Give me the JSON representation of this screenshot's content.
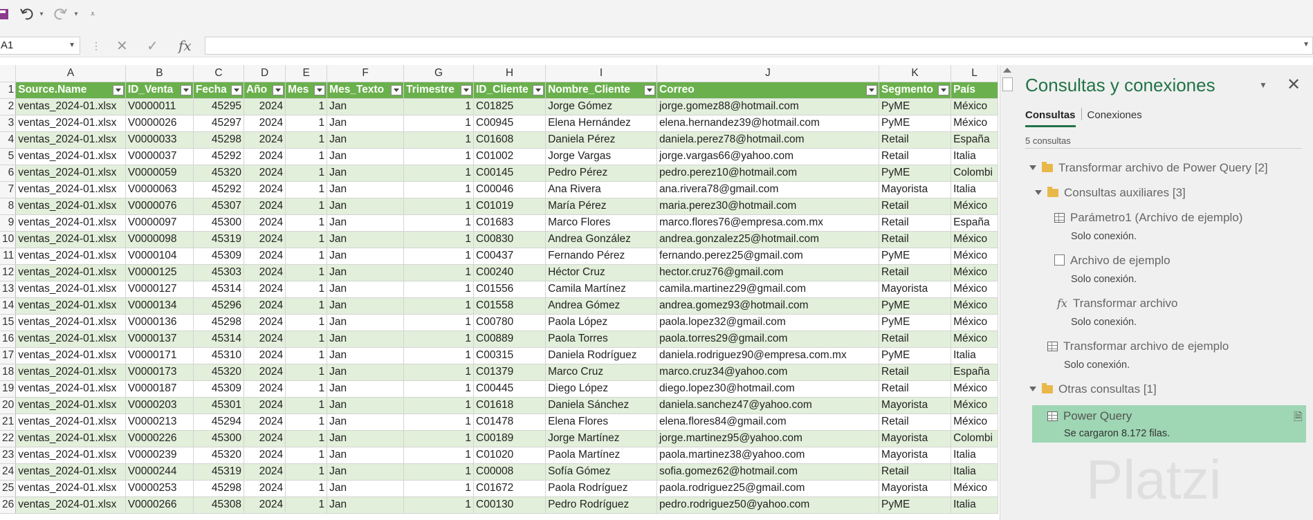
{
  "name_box": "A1",
  "formula_value": "",
  "columns": [
    "A",
    "B",
    "C",
    "D",
    "E",
    "F",
    "G",
    "H",
    "I",
    "J",
    "K",
    "L"
  ],
  "headers": [
    "Source.Name",
    "ID_Venta",
    "Fecha",
    "Año",
    "Mes",
    "Mes_Texto",
    "Trimestre",
    "ID_Cliente",
    "Nombre_Cliente",
    "Correo",
    "Segmento",
    "País"
  ],
  "rows": [
    {
      "n": "2",
      "source": "ventas_2024-01.xlsx",
      "id": "V0000011",
      "fecha": "45295",
      "anio": "2024",
      "mes": "1",
      "mtxt": "Jan",
      "trim": "1",
      "cli": "C01825",
      "nom": "Jorge Gómez",
      "mail": "jorge.gomez88@hotmail.com",
      "seg": "PyME",
      "pais": "México"
    },
    {
      "n": "3",
      "source": "ventas_2024-01.xlsx",
      "id": "V0000026",
      "fecha": "45297",
      "anio": "2024",
      "mes": "1",
      "mtxt": "Jan",
      "trim": "1",
      "cli": "C00945",
      "nom": "Elena Hernández",
      "mail": "elena.hernandez39@hotmail.com",
      "seg": "PyME",
      "pais": "México"
    },
    {
      "n": "4",
      "source": "ventas_2024-01.xlsx",
      "id": "V0000033",
      "fecha": "45298",
      "anio": "2024",
      "mes": "1",
      "mtxt": "Jan",
      "trim": "1",
      "cli": "C01608",
      "nom": "Daniela Pérez",
      "mail": "daniela.perez78@hotmail.com",
      "seg": "Retail",
      "pais": "España"
    },
    {
      "n": "5",
      "source": "ventas_2024-01.xlsx",
      "id": "V0000037",
      "fecha": "45292",
      "anio": "2024",
      "mes": "1",
      "mtxt": "Jan",
      "trim": "1",
      "cli": "C01002",
      "nom": "Jorge Vargas",
      "mail": "jorge.vargas66@yahoo.com",
      "seg": "Retail",
      "pais": "Italia"
    },
    {
      "n": "6",
      "source": "ventas_2024-01.xlsx",
      "id": "V0000059",
      "fecha": "45320",
      "anio": "2024",
      "mes": "1",
      "mtxt": "Jan",
      "trim": "1",
      "cli": "C00145",
      "nom": "Pedro Pérez",
      "mail": "pedro.perez10@hotmail.com",
      "seg": "PyME",
      "pais": "Colombi"
    },
    {
      "n": "7",
      "source": "ventas_2024-01.xlsx",
      "id": "V0000063",
      "fecha": "45292",
      "anio": "2024",
      "mes": "1",
      "mtxt": "Jan",
      "trim": "1",
      "cli": "C00046",
      "nom": "Ana Rivera",
      "mail": "ana.rivera78@gmail.com",
      "seg": "Mayorista",
      "pais": "Italia"
    },
    {
      "n": "8",
      "source": "ventas_2024-01.xlsx",
      "id": "V0000076",
      "fecha": "45307",
      "anio": "2024",
      "mes": "1",
      "mtxt": "Jan",
      "trim": "1",
      "cli": "C01019",
      "nom": "María Pérez",
      "mail": "maria.perez30@hotmail.com",
      "seg": "Retail",
      "pais": "México"
    },
    {
      "n": "9",
      "source": "ventas_2024-01.xlsx",
      "id": "V0000097",
      "fecha": "45300",
      "anio": "2024",
      "mes": "1",
      "mtxt": "Jan",
      "trim": "1",
      "cli": "C01683",
      "nom": "Marco Flores",
      "mail": "marco.flores76@empresa.com.mx",
      "seg": "Retail",
      "pais": "España"
    },
    {
      "n": "10",
      "source": "ventas_2024-01.xlsx",
      "id": "V0000098",
      "fecha": "45319",
      "anio": "2024",
      "mes": "1",
      "mtxt": "Jan",
      "trim": "1",
      "cli": "C00830",
      "nom": "Andrea González",
      "mail": "andrea.gonzalez25@hotmail.com",
      "seg": "Retail",
      "pais": "México"
    },
    {
      "n": "11",
      "source": "ventas_2024-01.xlsx",
      "id": "V0000104",
      "fecha": "45309",
      "anio": "2024",
      "mes": "1",
      "mtxt": "Jan",
      "trim": "1",
      "cli": "C00437",
      "nom": "Fernando Pérez",
      "mail": "fernando.perez25@gmail.com",
      "seg": "PyME",
      "pais": "México"
    },
    {
      "n": "12",
      "source": "ventas_2024-01.xlsx",
      "id": "V0000125",
      "fecha": "45303",
      "anio": "2024",
      "mes": "1",
      "mtxt": "Jan",
      "trim": "1",
      "cli": "C00240",
      "nom": "Héctor Cruz",
      "mail": "hector.cruz76@gmail.com",
      "seg": "Retail",
      "pais": "México"
    },
    {
      "n": "13",
      "source": "ventas_2024-01.xlsx",
      "id": "V0000127",
      "fecha": "45314",
      "anio": "2024",
      "mes": "1",
      "mtxt": "Jan",
      "trim": "1",
      "cli": "C01556",
      "nom": "Camila Martínez",
      "mail": "camila.martinez29@gmail.com",
      "seg": "Mayorista",
      "pais": "México"
    },
    {
      "n": "14",
      "source": "ventas_2024-01.xlsx",
      "id": "V0000134",
      "fecha": "45296",
      "anio": "2024",
      "mes": "1",
      "mtxt": "Jan",
      "trim": "1",
      "cli": "C01558",
      "nom": "Andrea Gómez",
      "mail": "andrea.gomez93@hotmail.com",
      "seg": "PyME",
      "pais": "México"
    },
    {
      "n": "15",
      "source": "ventas_2024-01.xlsx",
      "id": "V0000136",
      "fecha": "45298",
      "anio": "2024",
      "mes": "1",
      "mtxt": "Jan",
      "trim": "1",
      "cli": "C00780",
      "nom": "Paola López",
      "mail": "paola.lopez32@gmail.com",
      "seg": "PyME",
      "pais": "México"
    },
    {
      "n": "16",
      "source": "ventas_2024-01.xlsx",
      "id": "V0000137",
      "fecha": "45314",
      "anio": "2024",
      "mes": "1",
      "mtxt": "Jan",
      "trim": "1",
      "cli": "C00889",
      "nom": "Paola Torres",
      "mail": "paola.torres29@gmail.com",
      "seg": "Retail",
      "pais": "México"
    },
    {
      "n": "17",
      "source": "ventas_2024-01.xlsx",
      "id": "V0000171",
      "fecha": "45310",
      "anio": "2024",
      "mes": "1",
      "mtxt": "Jan",
      "trim": "1",
      "cli": "C00315",
      "nom": "Daniela Rodríguez",
      "mail": "daniela.rodriguez90@empresa.com.mx",
      "seg": "PyME",
      "pais": "Italia"
    },
    {
      "n": "18",
      "source": "ventas_2024-01.xlsx",
      "id": "V0000173",
      "fecha": "45320",
      "anio": "2024",
      "mes": "1",
      "mtxt": "Jan",
      "trim": "1",
      "cli": "C01379",
      "nom": "Marco Cruz",
      "mail": "marco.cruz34@yahoo.com",
      "seg": "Retail",
      "pais": "España"
    },
    {
      "n": "19",
      "source": "ventas_2024-01.xlsx",
      "id": "V0000187",
      "fecha": "45309",
      "anio": "2024",
      "mes": "1",
      "mtxt": "Jan",
      "trim": "1",
      "cli": "C00445",
      "nom": "Diego López",
      "mail": "diego.lopez30@hotmail.com",
      "seg": "Retail",
      "pais": "México"
    },
    {
      "n": "20",
      "source": "ventas_2024-01.xlsx",
      "id": "V0000203",
      "fecha": "45301",
      "anio": "2024",
      "mes": "1",
      "mtxt": "Jan",
      "trim": "1",
      "cli": "C01618",
      "nom": "Daniela Sánchez",
      "mail": "daniela.sanchez47@yahoo.com",
      "seg": "Mayorista",
      "pais": "México"
    },
    {
      "n": "21",
      "source": "ventas_2024-01.xlsx",
      "id": "V0000213",
      "fecha": "45294",
      "anio": "2024",
      "mes": "1",
      "mtxt": "Jan",
      "trim": "1",
      "cli": "C01478",
      "nom": "Elena Flores",
      "mail": "elena.flores84@gmail.com",
      "seg": "Retail",
      "pais": "México"
    },
    {
      "n": "22",
      "source": "ventas_2024-01.xlsx",
      "id": "V0000226",
      "fecha": "45300",
      "anio": "2024",
      "mes": "1",
      "mtxt": "Jan",
      "trim": "1",
      "cli": "C00189",
      "nom": "Jorge Martínez",
      "mail": "jorge.martinez95@yahoo.com",
      "seg": "Mayorista",
      "pais": "Colombi"
    },
    {
      "n": "23",
      "source": "ventas_2024-01.xlsx",
      "id": "V0000239",
      "fecha": "45320",
      "anio": "2024",
      "mes": "1",
      "mtxt": "Jan",
      "trim": "1",
      "cli": "C01020",
      "nom": "Paola Martínez",
      "mail": "paola.martinez38@yahoo.com",
      "seg": "Mayorista",
      "pais": "Italia"
    },
    {
      "n": "24",
      "source": "ventas_2024-01.xlsx",
      "id": "V0000244",
      "fecha": "45319",
      "anio": "2024",
      "mes": "1",
      "mtxt": "Jan",
      "trim": "1",
      "cli": "C00008",
      "nom": "Sofía Gómez",
      "mail": "sofia.gomez62@hotmail.com",
      "seg": "Retail",
      "pais": "Italia"
    },
    {
      "n": "25",
      "source": "ventas_2024-01.xlsx",
      "id": "V0000253",
      "fecha": "45298",
      "anio": "2024",
      "mes": "1",
      "mtxt": "Jan",
      "trim": "1",
      "cli": "C01672",
      "nom": "Paola Rodríguez",
      "mail": "paola.rodriguez25@gmail.com",
      "seg": "Mayorista",
      "pais": "México"
    },
    {
      "n": "26",
      "source": "ventas_2024-01.xlsx",
      "id": "V0000266",
      "fecha": "45308",
      "anio": "2024",
      "mes": "1",
      "mtxt": "Jan",
      "trim": "1",
      "cli": "C00130",
      "nom": "Pedro Rodríguez",
      "mail": "pedro.rodriguez50@yahoo.com",
      "seg": "PyME",
      "pais": "Italia"
    }
  ],
  "pane": {
    "title": "Consultas y conexiones",
    "tab_queries": "Consultas",
    "tab_connections": "Conexiones",
    "count": "5 consultas",
    "group1": "Transformar archivo de Power Query [2]",
    "group2": "Consultas auxiliares [3]",
    "q1": "Parámetro1 (Archivo de ejemplo)",
    "q1_status": "Solo conexión.",
    "q2": "Archivo de ejemplo",
    "q2_status": "Solo conexión.",
    "q3": "Transformar archivo",
    "q3_status": "Solo conexión.",
    "q4": "Transformar archivo de ejemplo",
    "q4_status": "Solo conexión.",
    "group3": "Otras consultas [1]",
    "q5": "Power Query",
    "q5_status": "Se cargaron 8.172 filas."
  },
  "watermark": "Platzi",
  "accent_color": "#217346",
  "header_color": "#6ab04c",
  "band_color": "#e2efda"
}
